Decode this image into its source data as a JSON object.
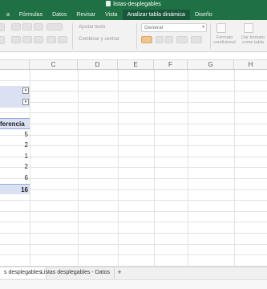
{
  "window": {
    "title": "listas-desplegables"
  },
  "ribbon_tabs": [
    "Fórmulas",
    "Datos",
    "Revisar",
    "Vista",
    "Analizar tabla dinámica",
    "Diseño"
  ],
  "ribbon_tab_first_partial": "a",
  "ribbon": {
    "wrap_text": "Ajustar texto",
    "merge_center": "Combinar y centrar",
    "number_format": "General",
    "conditional_format": "Formato condicional",
    "format_as_table": "Dar formato como tabla"
  },
  "columns": [
    "C",
    "D",
    "E",
    "F",
    "G",
    "H"
  ],
  "cells": {
    "header_partial": "ferencia",
    "values": [
      "5",
      "2",
      "1",
      "2",
      "6"
    ],
    "total": "16"
  },
  "sheets": [
    "Listas desplegables",
    "Listas desplegables - Datos"
  ],
  "sheet_first_partial": "s desplegables",
  "add_sheet": "+"
}
